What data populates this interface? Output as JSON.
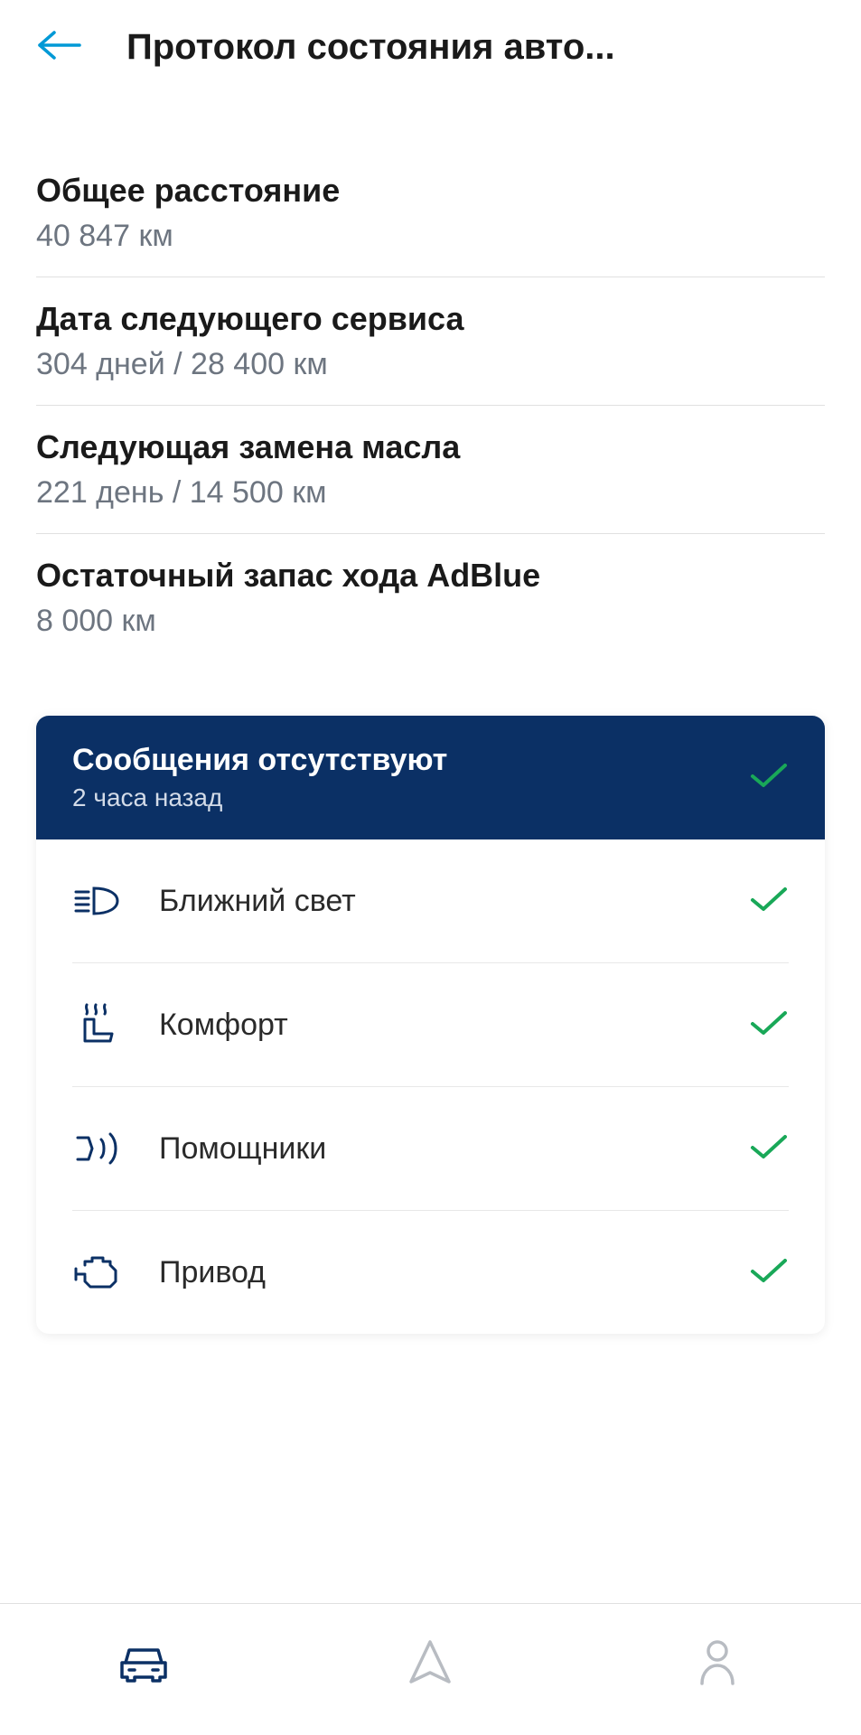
{
  "header": {
    "title": "Протокол состояния авто..."
  },
  "info": [
    {
      "label": "Общее расстояние",
      "value": "40 847 км"
    },
    {
      "label": "Дата следующего сервиса",
      "value": "304 дней / 28 400 км"
    },
    {
      "label": "Следующая замена масла",
      "value": "221 день / 14 500 км"
    },
    {
      "label": "Остаточный запас хода AdBlue",
      "value": "8 000 км"
    }
  ],
  "status": {
    "title": "Сообщения отсутствуют",
    "subtitle": "2 часа назад",
    "items": [
      {
        "label": "Ближний свет"
      },
      {
        "label": "Комфорт"
      },
      {
        "label": "Помощники"
      },
      {
        "label": "Привод"
      }
    ]
  }
}
